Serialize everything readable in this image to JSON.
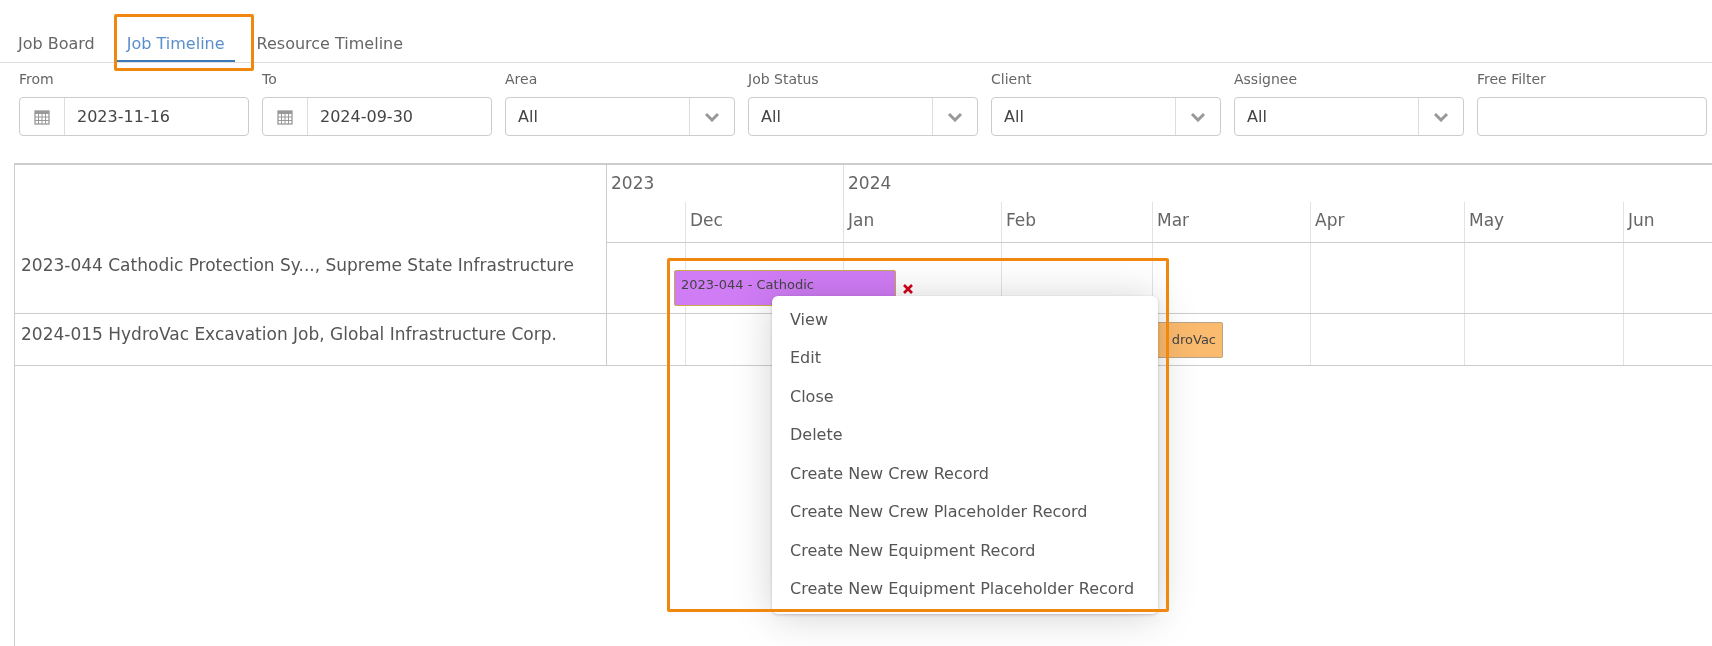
{
  "tabs": [
    {
      "label": "Job Board",
      "selected": false
    },
    {
      "label": "Job Timeline",
      "selected": true
    },
    {
      "label": "Resource Timeline",
      "selected": false
    }
  ],
  "filters": [
    {
      "label": "From",
      "kind": "date",
      "value": "2023-11-16"
    },
    {
      "label": "To",
      "kind": "date",
      "value": "2024-09-30"
    },
    {
      "label": "Area",
      "kind": "select",
      "value": "All"
    },
    {
      "label": "Job Status",
      "kind": "select",
      "value": "All"
    },
    {
      "label": "Client",
      "kind": "select",
      "value": "All"
    },
    {
      "label": "Assignee",
      "kind": "select",
      "value": "All"
    },
    {
      "label": "Free Filter",
      "kind": "text"
    }
  ],
  "timeline": {
    "years": [
      {
        "label": "2023"
      },
      {
        "label": "2024"
      }
    ],
    "months": [
      {
        "label": "Dec"
      },
      {
        "label": "Jan"
      },
      {
        "label": "Feb"
      },
      {
        "label": "Mar"
      },
      {
        "label": "Apr"
      },
      {
        "label": "May"
      },
      {
        "label": "Jun"
      }
    ],
    "rows": [
      {
        "label": "2023-044 Cathodic Protection Sy..., Supreme State Infrastructure",
        "bar": {
          "label": "2023-044 - Cathodic",
          "color": "#d07cf5",
          "removable": true
        }
      },
      {
        "label": "2024-015 HydroVac Excavation Job, Global Infrastructure Corp.",
        "bar": {
          "label": "droVac",
          "color": "#fbbb6e",
          "removable": false
        }
      }
    ]
  },
  "context_menu": {
    "items": [
      {
        "label": "View"
      },
      {
        "label": "Edit"
      },
      {
        "label": "Close"
      },
      {
        "label": "Delete"
      },
      {
        "label": "Create New Crew Record"
      },
      {
        "label": "Create New Crew Placeholder Record"
      },
      {
        "label": "Create New Equipment Record"
      },
      {
        "label": "Create New Equipment Placeholder Record"
      }
    ]
  }
}
